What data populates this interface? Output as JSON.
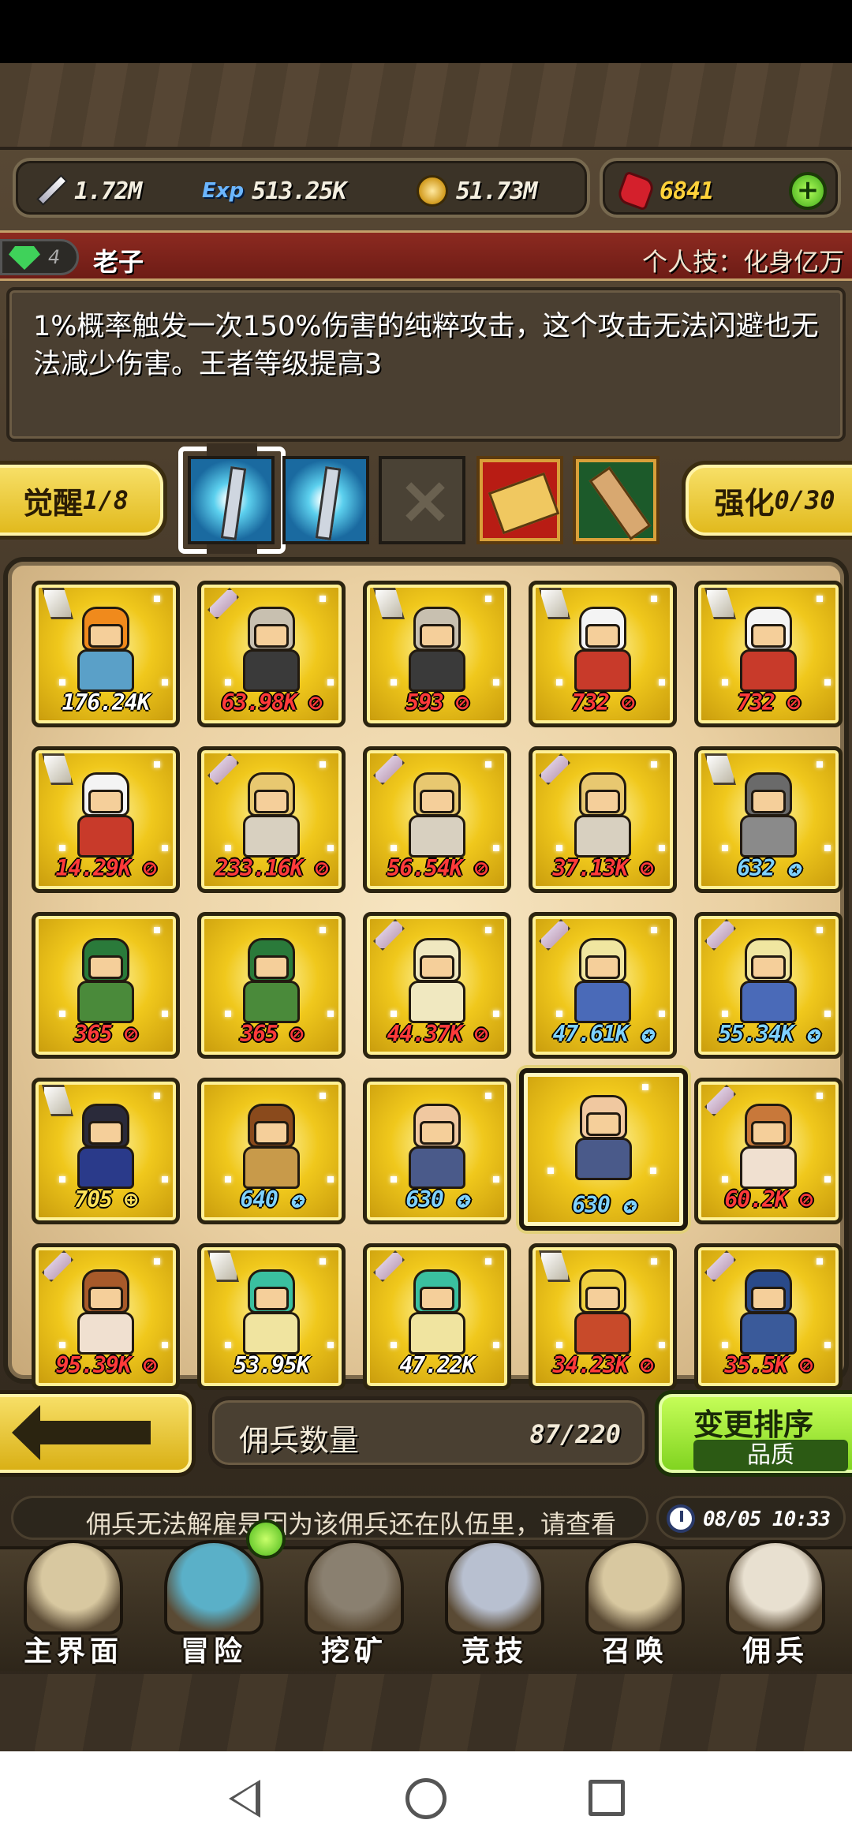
{
  "resources": {
    "attack": {
      "icon": "sword-icon",
      "value": "1.72M"
    },
    "exp": {
      "icon": "exp-icon",
      "label": "Exp",
      "value": "513.25K"
    },
    "gold": {
      "icon": "coin-icon",
      "value": "51.73M"
    },
    "gems": {
      "icon": "ruby-icon",
      "value": "6841"
    }
  },
  "hero": {
    "rank": "4",
    "name": "老子",
    "personal_skill": "个人技：化身亿万",
    "description": "1%概率触发一次150%伤害的纯粹攻击，这个攻击无法闪避也无法减少伤害。王者等级提高3"
  },
  "awaken": {
    "label": "觉醒",
    "value": "1/8"
  },
  "enhance": {
    "label": "强化",
    "value": "0/30"
  },
  "skill_slots": [
    "ice-chain-icon",
    "ice-chain-icon",
    "empty-slot-icon",
    "red-scroll-icon",
    "green-scroll-icon"
  ],
  "heroes": [
    {
      "value": "176.24K",
      "color": "white",
      "type": "def",
      "hair": "#f08a1c",
      "body": "#5aa0c8"
    },
    {
      "value": "63.98K",
      "color": "red",
      "type": "atk",
      "hair": "#c8c0b0",
      "body": "#3a3a3a"
    },
    {
      "value": "593",
      "color": "red",
      "type": "def",
      "hair": "#c8c0b0",
      "body": "#3a3a3a"
    },
    {
      "value": "732",
      "color": "red",
      "type": "def",
      "hair": "#f4f4f4",
      "body": "#c83a2a"
    },
    {
      "value": "732",
      "color": "red",
      "type": "def",
      "hair": "#f4f4f4",
      "body": "#c83a2a"
    },
    {
      "value": "14.29K",
      "color": "red",
      "type": "def",
      "hair": "#f4f4f4",
      "body": "#c83a2a"
    },
    {
      "value": "233.16K",
      "color": "red",
      "type": "atk",
      "hair": "#e8c870",
      "body": "#d8d0c0"
    },
    {
      "value": "56.54K",
      "color": "red",
      "type": "atk",
      "hair": "#e8c870",
      "body": "#d8d0c0"
    },
    {
      "value": "37.13K",
      "color": "red",
      "type": "atk",
      "hair": "#e8c870",
      "body": "#d8d0c0"
    },
    {
      "value": "632",
      "color": "blue",
      "type": "def",
      "hair": "#6a6a6a",
      "body": "#8a8a8a"
    },
    {
      "value": "365",
      "color": "red",
      "type": "none",
      "hair": "#2a7a3a",
      "body": "#4a8a3a"
    },
    {
      "value": "365",
      "color": "red",
      "type": "none",
      "hair": "#2a7a3a",
      "body": "#4a8a3a"
    },
    {
      "value": "44.37K",
      "color": "red",
      "type": "atk",
      "hair": "#f0e8c0",
      "body": "#f0e8c0"
    },
    {
      "value": "47.61K",
      "color": "blue",
      "type": "atk",
      "hair": "#f0e6a0",
      "body": "#4a6ab8"
    },
    {
      "value": "55.34K",
      "color": "blue",
      "type": "atk",
      "hair": "#f0e6a0",
      "body": "#4a6ab8"
    },
    {
      "value": "705",
      "color": "yellow",
      "type": "def",
      "hair": "#2a2a3a",
      "body": "#2a3a8a"
    },
    {
      "value": "640",
      "color": "blue",
      "type": "none",
      "hair": "#8a4a1c",
      "body": "#c89a4a"
    },
    {
      "value": "630",
      "color": "blue",
      "type": "none",
      "hair": "#f0c8a0",
      "body": "#4a5a8a"
    },
    {
      "value": "630",
      "color": "blue",
      "type": "none",
      "hair": "#f0c8a0",
      "body": "#4a5a8a",
      "selected": true
    },
    {
      "value": "60.2K",
      "color": "red",
      "type": "atk",
      "hair": "#c8783a",
      "body": "#f0e0d0"
    },
    {
      "value": "95.39K",
      "color": "red",
      "type": "atk",
      "hair": "#a85a2a",
      "body": "#f0e0d0"
    },
    {
      "value": "53.95K",
      "color": "white",
      "type": "def",
      "hair": "#3ac0a0",
      "body": "#f0e4a0"
    },
    {
      "value": "47.22K",
      "color": "white",
      "type": "atk",
      "hair": "#3ac0a0",
      "body": "#f0e4a0"
    },
    {
      "value": "34.23K",
      "color": "red",
      "type": "def",
      "hair": "#f0d040",
      "body": "#c84a2a"
    },
    {
      "value": "35.5K",
      "color": "red",
      "type": "atk",
      "hair": "#2a4a8a",
      "body": "#3a5a9a"
    }
  ],
  "bottom": {
    "mercenary_label": "佣兵数量",
    "mercenary_count": "87/220",
    "sort_label": "变更排序",
    "sort_value": "品质"
  },
  "tip": "佣兵无法解雇是因为该佣兵还在队伍里，请查看",
  "time": "08/05 10:33",
  "nav": [
    {
      "label": "主界面",
      "icon": "map-scroll-icon",
      "color": "#d8c8a0"
    },
    {
      "label": "冒险",
      "icon": "island-icon",
      "color": "#5ab0c8"
    },
    {
      "label": "挖矿",
      "icon": "pickaxe-icon",
      "color": "#8a8070"
    },
    {
      "label": "竞技",
      "icon": "crossed-swords-icon",
      "color": "#b8c0d0"
    },
    {
      "label": "召唤",
      "icon": "summon-scroll-icon",
      "color": "#d8c8a0"
    },
    {
      "label": "佣兵",
      "icon": "tent-icon",
      "color": "#e8e0d0"
    }
  ],
  "colors": {
    "accent_yellow": "#f0c81c",
    "name_bar": "#8c2a20",
    "sort_green": "#7ed21e"
  }
}
